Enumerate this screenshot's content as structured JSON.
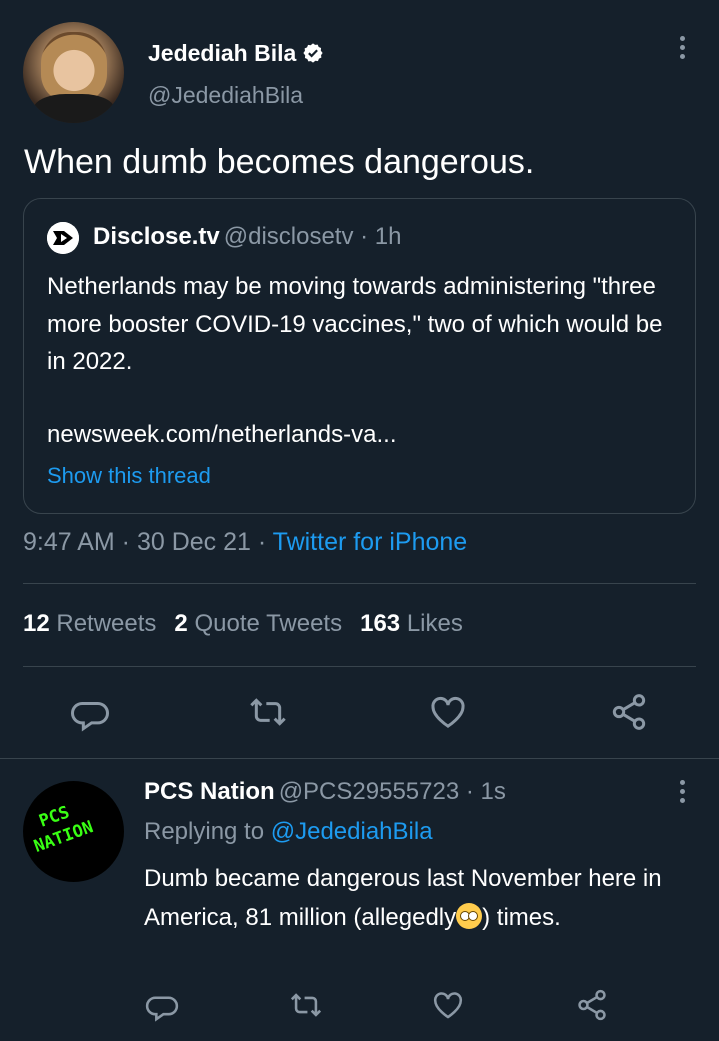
{
  "main_tweet": {
    "author_name": "Jedediah Bila",
    "author_handle": "@JedediahBila",
    "text": "When dumb becomes dangerous.",
    "timestamp": "9:47 AM · 30 Dec 21 · ",
    "source": "Twitter for iPhone"
  },
  "quote": {
    "author_name": "Disclose.tv",
    "author_handle": "@disclosetv · 1h",
    "text": "Netherlands may be moving towards administering \"three more booster COVID-19 vaccines,\" two of which would be in 2022.",
    "link": "newsweek.com/netherlands-va...",
    "show_thread": "Show this thread"
  },
  "stats": {
    "retweets_count": "12",
    "retweets_label": "Retweets",
    "quotes_count": "2",
    "quotes_label": "Quote Tweets",
    "likes_count": "163",
    "likes_label": "Likes"
  },
  "reply": {
    "author_name": "PCS Nation",
    "author_handle": "@PCS29555723 · 1s",
    "replying_to_label": "Replying to ",
    "replying_to_handle": "@JedediahBila",
    "text_before_emoji": "Dumb became dangerous last November here in America, 81 million (allegedly",
    "text_after_emoji": ") times.",
    "avatar_text_1": "PCS",
    "avatar_text_2": "NATION"
  },
  "icons": [
    "verified-badge-icon",
    "more-options-icon",
    "reply-icon",
    "retweet-icon",
    "like-icon",
    "share-icon",
    "rolling-eyes-emoji"
  ],
  "colors": {
    "background": "#15202b",
    "accent": "#1d9bf0",
    "muted": "#8b98a5",
    "border": "#38444d"
  }
}
